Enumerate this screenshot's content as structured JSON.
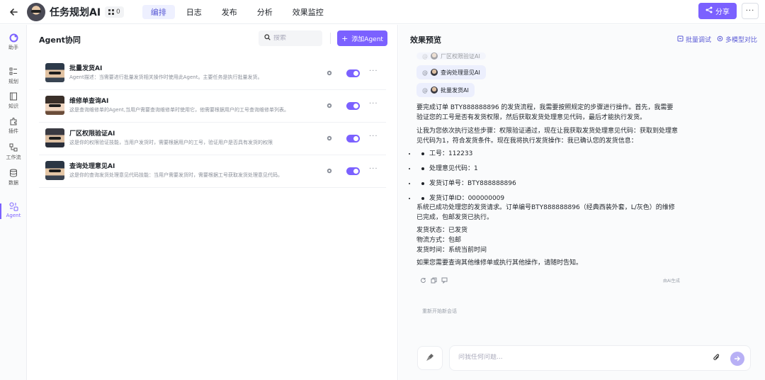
{
  "header": {
    "app_title": "任务规划AI",
    "badge_count": "0",
    "tabs": [
      {
        "label": "编排"
      },
      {
        "label": "日志"
      },
      {
        "label": "发布"
      },
      {
        "label": "分析"
      },
      {
        "label": "效果监控"
      }
    ],
    "share_label": "分享"
  },
  "rail": {
    "items": [
      {
        "label": "助手",
        "icon": "assistant-icon"
      },
      {
        "label": "规划",
        "icon": "plan-icon"
      },
      {
        "label": "知识",
        "icon": "knowledge-icon"
      },
      {
        "label": "插件",
        "icon": "plugin-icon"
      },
      {
        "label": "工作流",
        "icon": "workflow-icon"
      },
      {
        "label": "数据",
        "icon": "database-icon"
      },
      {
        "label": "Agent",
        "icon": "agent-icon"
      }
    ]
  },
  "agents_panel": {
    "title": "Agent协同",
    "search_placeholder": "搜索",
    "add_label": "添加Agent",
    "agents": [
      {
        "name": "批量发货AI",
        "desc": "Agent描述：当需要进行批量发货相关操作时使用此Agent。主要任务是执行批量发货。",
        "enabled": true
      },
      {
        "name": "维修单查询AI",
        "desc": "这是查询维修单的Agent,当用户需要查询维修单时使用它，他需要根据用户的工号查询维修单列表。",
        "enabled": true
      },
      {
        "name": "厂区权限验证AI",
        "desc": "这是你的权限验证技能，当用户发货时，需要根据用户的工号，验证用户是否具有发货的权限",
        "enabled": true
      },
      {
        "name": "查询处理意见AI",
        "desc": "这是你的查询发货处理意见代码技能：当用户需要发货时，需要根据工号获取发货处理意见代码。",
        "enabled": true
      }
    ]
  },
  "preview": {
    "title": "效果预览",
    "batch_debug": "批量调试",
    "multi_model": "多模型对比",
    "chips": [
      {
        "label": "厂区权限验证AI"
      },
      {
        "label": "查询处理意见AI"
      },
      {
        "label": "批量发货AI"
      }
    ],
    "para1": "要完成订单 BTY888888896 的发货流程，我需要按照规定的步骤进行操作。首先，我需要验证您的工号是否有发货权限，然后获取发货处理意见代码，最后才能执行发货。",
    "para2": "让我为您依次执行这些步骤：权限验证通过，现在让我获取发货处理意见代码：获取到处理意见代码为1，符合发货条件。现在我将执行发货操作：我已确认您的发货信息：",
    "bullets": [
      "工号：112233",
      "处理意见代码：1",
      "发货订单号：BTY888888896",
      "发货订单ID：000000009"
    ],
    "para3": "系统已成功处理您的发货请求。订单编号BTY888888896（经典西装外套，L/灰色）的维修已完成，包邮发货已执行。",
    "status_lines": [
      "发货状态：已发货",
      "物流方式：包邮",
      "发货时间：系统当前时间"
    ],
    "para4": "如果您需要查询其他维修单或执行其他操作，请随时告知。",
    "ai_generated": "由AI生成",
    "restart": "重新开始新会话",
    "input_placeholder": "问我任何问题..."
  },
  "colors": {
    "accent": "#7b61ff",
    "accent_soft": "#eef0ff"
  }
}
